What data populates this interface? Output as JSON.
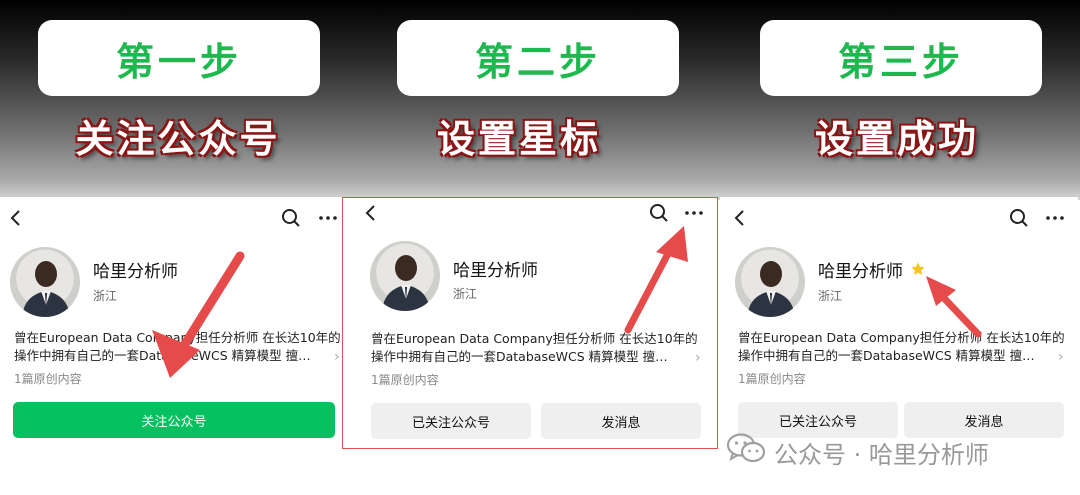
{
  "steps": [
    {
      "badge": "第一步",
      "caption": "关注公众号",
      "account_name": "哈里分析师",
      "location": "浙江",
      "bio_line1": "曾在European Data Company担任分析师 在长达10年的",
      "bio_line2": "操作中拥有自己的一套DatabaseWCS 精算模型 擅…",
      "article_count": "1篇原创内容",
      "follow_button": "关注公众号"
    },
    {
      "badge": "第二步",
      "caption": "设置星标",
      "account_name": "哈里分析师",
      "location": "浙江",
      "bio_line1": "曾在European Data Company担任分析师 在长达10年的",
      "bio_line2": "操作中拥有自己的一套DatabaseWCS 精算模型 擅…",
      "article_count": "1篇原创内容",
      "followed_button": "已关注公众号",
      "message_button": "发消息"
    },
    {
      "badge": "第三步",
      "caption": "设置成功",
      "account_name": "哈里分析师",
      "location": "浙江",
      "bio_line1": "曾在European Data Company担任分析师 在长达10年的",
      "bio_line2": "操作中拥有自己的一套DatabaseWCS 精算模型 擅…",
      "article_count": "1篇原创内容",
      "followed_button": "已关注公众号",
      "message_button": "发消息"
    }
  ],
  "watermark": {
    "text": "公众号 · 哈里分析师"
  },
  "colors": {
    "accent_green": "#07c160",
    "badge_text": "#1fb84e",
    "arrow": "#e64b4b",
    "star": "#f5c518"
  },
  "icons": [
    "chevron-left-icon",
    "search-icon",
    "more-icon",
    "star-icon",
    "chevron-right-icon",
    "wechat-icon"
  ]
}
